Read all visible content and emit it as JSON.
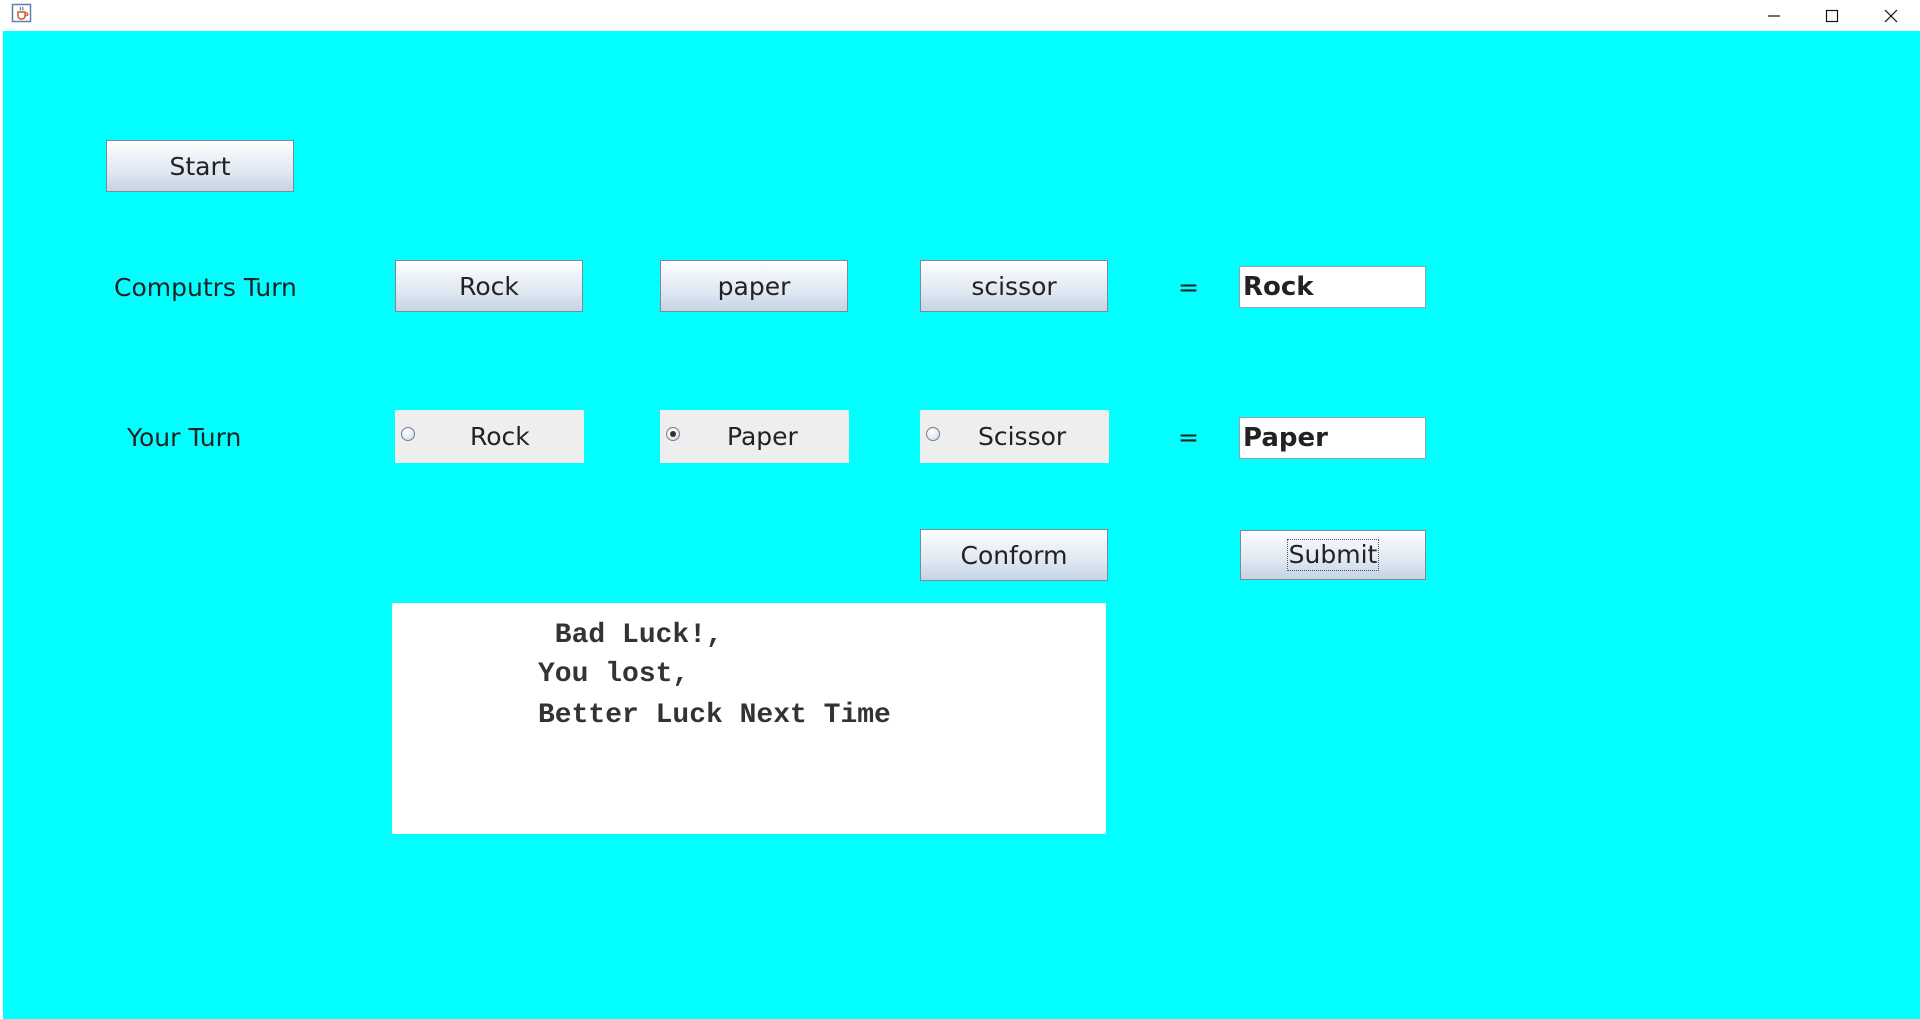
{
  "window": {
    "controls": [
      "minimize-icon",
      "maximize-icon",
      "close-icon"
    ]
  },
  "start_button": "Start",
  "computer_row": {
    "label": "Computrs Turn",
    "buttons": [
      "Rock",
      "paper",
      "scissor"
    ],
    "equals": "=",
    "result": "Rock"
  },
  "player_row": {
    "label": "Your Turn",
    "options": [
      {
        "label": "Rock",
        "selected": false
      },
      {
        "label": "Paper",
        "selected": true
      },
      {
        "label": "Scissor",
        "selected": false
      }
    ],
    "equals": "=",
    "result": "Paper"
  },
  "conform_button": "Conform",
  "submit_button": "Submit",
  "message": {
    "line1": " Bad Luck!,",
    "line2": "You lost,",
    "line3": "Better Luck Next Time"
  },
  "colors": {
    "background": "#00ffff",
    "textarea": "#ffffff"
  }
}
